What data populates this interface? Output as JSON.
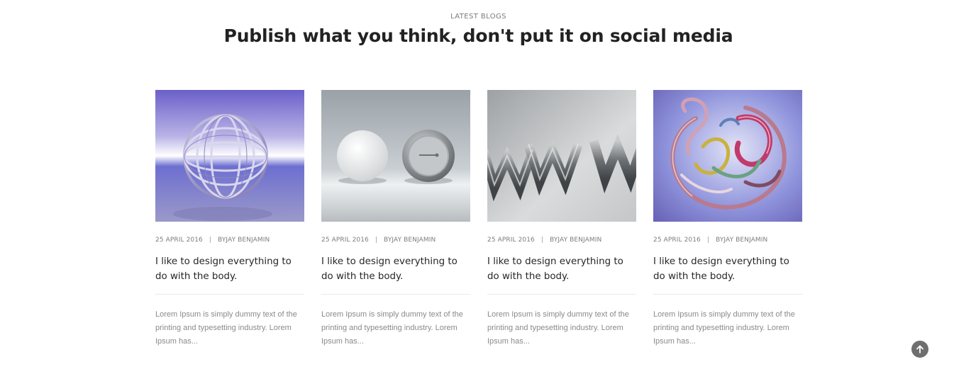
{
  "section": {
    "eyebrow": "LATEST BLOGS",
    "title": "Publish what you think, don't put it on social media"
  },
  "posts": [
    {
      "image_icon": "wire-sphere-image",
      "date": "25 APRIL 2016",
      "author": "BYJAY BENJAMIN",
      "title": "I like to design everything to do with the body.",
      "excerpt": "Lorem Ipsum is simply dummy text of the printing and typesetting industry. Lorem Ipsum has..."
    },
    {
      "image_icon": "buttons-image",
      "date": "25 APRIL 2016",
      "author": "BYJAY BENJAMIN",
      "title": "I like to design everything to do with the body.",
      "excerpt": "Lorem Ipsum is simply dummy text of the printing and typesetting industry. Lorem Ipsum has..."
    },
    {
      "image_icon": "www-3d-image",
      "date": "25 APRIL 2016",
      "author": "BYJAY BENJAMIN",
      "title": "I like to design everything to do with the body.",
      "excerpt": "Lorem Ipsum is simply dummy text of the printing and typesetting industry. Lorem Ipsum has..."
    },
    {
      "image_icon": "abstract-glass-image",
      "date": "25 APRIL 2016",
      "author": "BYJAY BENJAMIN",
      "title": "I like to design everything to do with the body.",
      "excerpt": "Lorem Ipsum is simply dummy text of the printing and typesetting industry. Lorem Ipsum has..."
    }
  ],
  "meta_separator": "|",
  "back_to_top": {
    "icon": "arrow-up-icon",
    "color": "#6f6f6f"
  }
}
